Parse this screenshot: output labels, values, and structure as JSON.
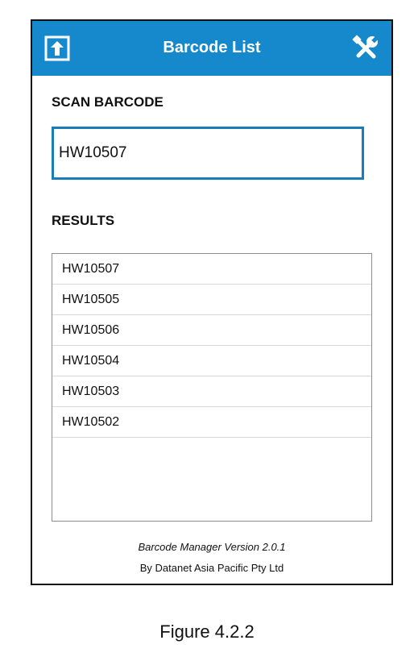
{
  "header": {
    "title": "Barcode List",
    "left_icon": "upload-icon",
    "right_icon": "wrench-screwdriver-icon",
    "background_color": "#1689cc"
  },
  "scan": {
    "label": "SCAN BARCODE",
    "value": "HW10507",
    "border_color": "#1a7db6"
  },
  "results": {
    "label": "RESULTS",
    "items": [
      "HW10507",
      "HW10505",
      "HW10506",
      "HW10504",
      "HW10503",
      "HW10502"
    ]
  },
  "footer": {
    "version": "Barcode Manager Version 2.0.1",
    "company": "By Datanet Asia Pacific Pty Ltd"
  },
  "caption": "Figure 4.2.2"
}
